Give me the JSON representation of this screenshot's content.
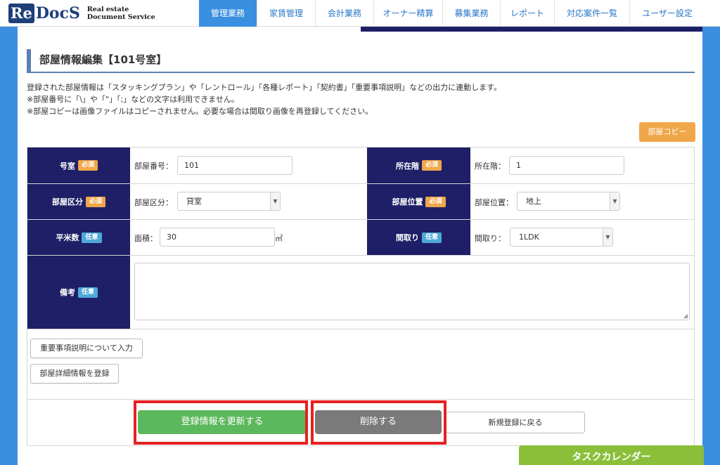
{
  "logo": {
    "mark_re": "Re",
    "mark_docs": "DocS",
    "tagline_1": "Real estate",
    "tagline_2": "Document Service"
  },
  "nav": {
    "items": [
      {
        "label": "管理業務",
        "active": true
      },
      {
        "label": "家賃管理",
        "active": false
      },
      {
        "label": "会計業務",
        "active": false
      },
      {
        "label": "オーナー精算",
        "active": false
      },
      {
        "label": "募集業務",
        "active": false
      },
      {
        "label": "レポート",
        "active": false
      },
      {
        "label": "対応案件一覧",
        "active": false
      },
      {
        "label": "ユーザー設定",
        "active": false
      }
    ]
  },
  "page": {
    "title": "部屋情報編集【101号室】",
    "desc": [
      "登録された部屋情報は「スタッキングプラン」や「レントロール」「各種レポート」「契約書」「重要事項説明」などの出力に連動します。",
      "※部屋番号に「\\」や「\"」「;」などの文字は利用できません。",
      "※部屋コピーは画像ファイルはコピーされません。必要な場合は間取り画像を再登録してください。"
    ],
    "copy_button": "部屋コピー"
  },
  "form": {
    "badge_required": "必須",
    "badge_optional": "任意",
    "room_number": {
      "label": "号室",
      "inline_label": "部屋番号：",
      "value": "101"
    },
    "floor": {
      "label": "所在階",
      "inline_label": "所在階：",
      "value": "1"
    },
    "room_type": {
      "label": "部屋区分",
      "inline_label": "部屋区分：",
      "value": "貸室"
    },
    "room_position": {
      "label": "部屋位置",
      "inline_label": "部屋位置：",
      "value": "地上"
    },
    "area": {
      "label": "平米数",
      "inline_label": "面積：",
      "value": "30",
      "unit": "㎡"
    },
    "layout": {
      "label": "間取り",
      "inline_label": "間取り：",
      "value": "1LDK"
    },
    "notes": {
      "label": "備考",
      "value": ""
    },
    "important_btn": "重要事項説明について入力",
    "details_btn": "部屋詳細情報を登録"
  },
  "actions": {
    "update": "登録情報を更新する",
    "delete": "削除する",
    "back": "新規登録に戻る"
  },
  "task_calendar": "タスクカレンダー",
  "colors": {
    "brand_blue": "#3a8fe0",
    "label_navy": "#1e1f66",
    "required_orange": "#f0a74a",
    "optional_blue": "#4ea9d9",
    "update_green": "#5cb85c",
    "highlight_red": "#e62020"
  }
}
